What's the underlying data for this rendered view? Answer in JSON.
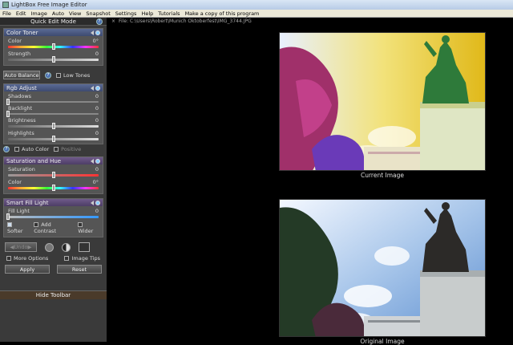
{
  "window": {
    "title": "LightBox Free Image Editor"
  },
  "menu": [
    "File",
    "Edit",
    "Image",
    "Auto",
    "View",
    "Snapshot",
    "Settings",
    "Help",
    "Tutorials",
    "Make a copy of this program"
  ],
  "sidebar": {
    "mode_title": "Quick Edit Mode",
    "color_toner": {
      "title": "Color Toner",
      "color_label": "Color",
      "color_value": "0°",
      "strength_label": "Strength",
      "strength_value": "0",
      "color_level": 0.5,
      "strength_level": 0.5
    },
    "auto_balance": {
      "button": "Auto Balance",
      "low_tones": "Low Tones"
    },
    "rgb_adjust": {
      "title": "Rgb Adjust",
      "rows": [
        {
          "label": "Shadows",
          "value": "0",
          "level": 0.0
        },
        {
          "label": "Backlight",
          "value": "0",
          "level": 0.0
        },
        {
          "label": "Brightness",
          "value": "0",
          "level": 0.5
        },
        {
          "label": "Highlights",
          "value": "0",
          "level": 0.5
        }
      ]
    },
    "auto_color": {
      "label": "Auto Color",
      "positive": "Positive"
    },
    "sat_hue": {
      "title": "Saturation and Hue",
      "sat_label": "Saturation",
      "sat_value": "0",
      "color_label": "Color",
      "color_value": "0°",
      "sat_level": 0.5,
      "color_level": 0.5
    },
    "smart_fill": {
      "title": "Smart Fill Light",
      "fill_label": "Fill Light",
      "fill_value": "0",
      "fill_level": 0.0,
      "softer": "Softer",
      "add_contrast": "Add Contrast",
      "wider": "Wider"
    },
    "undo": {
      "label": "Undo"
    },
    "more_options": "More Options",
    "image_tips": "Image Tips",
    "apply": "Apply",
    "reset": "Reset",
    "hide_toolbar": "Hide Toolbar"
  },
  "viewer": {
    "file_path": "File: C:\\Users\\Robert\\Munich Oktoberfest\\IMG_3744.JPG",
    "current_label": "Current Image",
    "original_label": "Original Image"
  }
}
